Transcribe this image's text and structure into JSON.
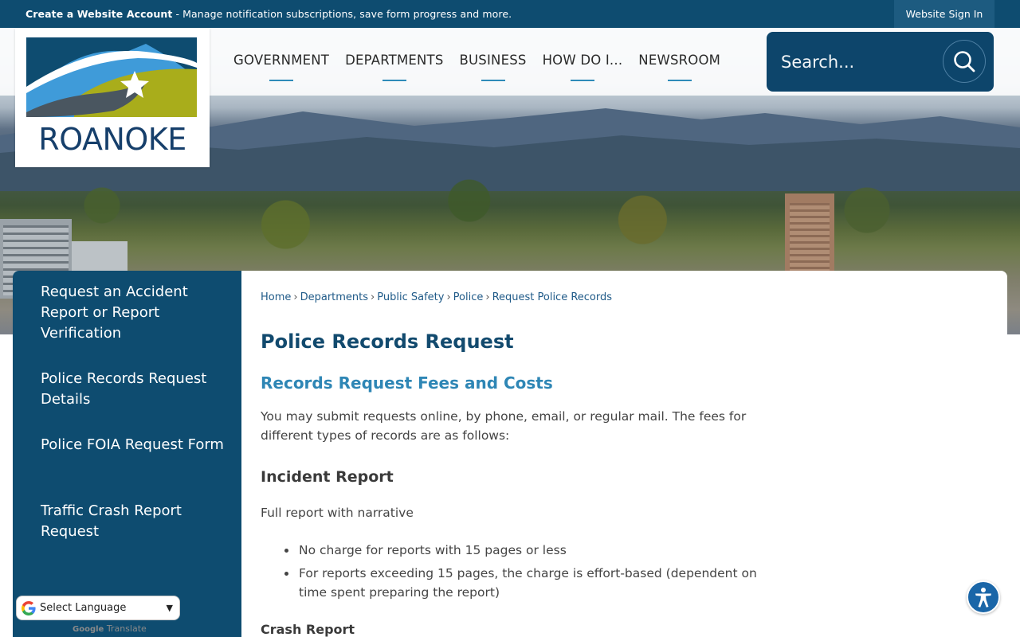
{
  "topbar": {
    "account_bold": "Create a Website Account",
    "account_rest": " - Manage notification subscriptions, save form progress and more.",
    "signin": "Website Sign In"
  },
  "logo": {
    "wordmark": "ROANOKE",
    "colors": {
      "navy": "#0e4c70",
      "blue": "#3f9bd9",
      "olive": "#a9ad1b",
      "gray": "#4a5660"
    }
  },
  "nav": {
    "items": [
      "GOVERNMENT",
      "DEPARTMENTS",
      "BUSINESS",
      "HOW DO I...",
      "NEWSROOM"
    ]
  },
  "search": {
    "placeholder": "Search..."
  },
  "sidebar": {
    "links": [
      "Request an Accident Report or Report Verification",
      "Police Records Request Details",
      "Police FOIA Request Form",
      "Traffic Crash Report Request"
    ]
  },
  "translate": {
    "label": "Select Language",
    "powered_by": "Google",
    "translate_word": "Translate"
  },
  "breadcrumb": [
    "Home",
    "Departments",
    "Public Safety",
    "Police",
    "Request Police Records"
  ],
  "content": {
    "title": "Police Records Request",
    "subtitle": "Records Request Fees and Costs",
    "intro": "You may submit requests online, by phone, email, or regular mail. The fees for different types of records are as follows:",
    "incident_heading": "Incident Report",
    "incident_sub": "Full report with narrative",
    "incident_bullets": [
      "No charge for reports with 15 pages or less",
      "For reports exceeding 15 pages, the charge is effort-based (dependent on time spent preparing the report)"
    ],
    "crash_heading": "Crash Report"
  },
  "accessibility": {
    "icon": "accessibility-icon"
  }
}
